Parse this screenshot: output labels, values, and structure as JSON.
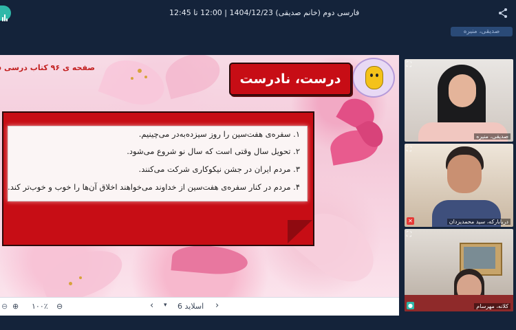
{
  "header": {
    "title": "فارسی دوم (خانم صدیقی) 1404/12/23 | 12:00 تا 12:45",
    "user_badge": "صدیقی، منیره"
  },
  "slide": {
    "page_reference": "صفحه ی ۹۶ کتاب درسی فا",
    "header_label": "درست، نادرست",
    "statements": [
      "۱. سفره‌ی هفت‌سین را روز سیزده‌به‌در می‌چینیم.",
      "۲. تحویل سال وقتی است که سال نو شروع می‌شود.",
      "۳. مردم ایران در جشن نیکوکاری شرکت می‌کنند.",
      "۴. مردم در کنار سفره‌ی هفت‌سین از خداوند می‌خواهند اخلاق آن‌ها را خوب و خوب‌تر کند."
    ]
  },
  "controls": {
    "zoom": "۱۰۰٪",
    "slide_label": "اسلاید 6"
  },
  "participants": [
    {
      "name": "صدیقی، منیره"
    },
    {
      "name": "دریابارکه، سید محمدیزدان"
    },
    {
      "name": "کلانه، مهرسام"
    }
  ],
  "colors": {
    "accent": "#c70d15",
    "topbar": "#14233a",
    "brand": "#2fb8a9"
  }
}
